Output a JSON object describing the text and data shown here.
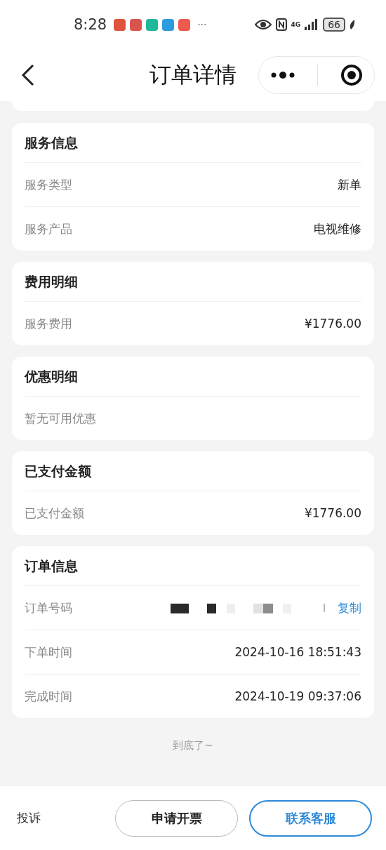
{
  "status_bar": {
    "time": "8:28",
    "notifications": [
      {
        "color": "#e0533d"
      },
      {
        "color": "#d9534f"
      },
      {
        "color": "#1fb89a"
      },
      {
        "color": "#2d9be0"
      },
      {
        "color": "#ef5a50"
      }
    ],
    "more": "···",
    "network": "4G",
    "battery": "66"
  },
  "nav": {
    "title": "订单详情"
  },
  "sections": [
    {
      "title": "服务信息",
      "rows": [
        {
          "label": "服务类型",
          "value": "新单"
        },
        {
          "label": "服务产品",
          "value": "电视维修"
        }
      ]
    },
    {
      "title": "费用明细",
      "rows": [
        {
          "label": "服务费用",
          "value": "¥1776.00"
        }
      ]
    },
    {
      "title": "优惠明细",
      "rows": [
        {
          "label": "暂无可用优惠"
        }
      ]
    },
    {
      "title": "已支付金额",
      "rows": [
        {
          "label": "已支付金额",
          "value": "¥1776.00"
        }
      ]
    },
    {
      "title": "订单信息",
      "rows": [
        {
          "label": "订单号码",
          "redacted": true,
          "action": "复制"
        },
        {
          "label": "下单时间",
          "value": "2024-10-16 18:51:43"
        },
        {
          "label": "完成时间",
          "value": "2024-10-19 09:37:06"
        }
      ]
    }
  ],
  "end_note": "到底了~",
  "bottom_bar": {
    "complaint": "投诉",
    "buttons": [
      {
        "label": "申请开票",
        "kind": "outline"
      },
      {
        "label": "联系客服",
        "kind": "primary"
      }
    ]
  }
}
